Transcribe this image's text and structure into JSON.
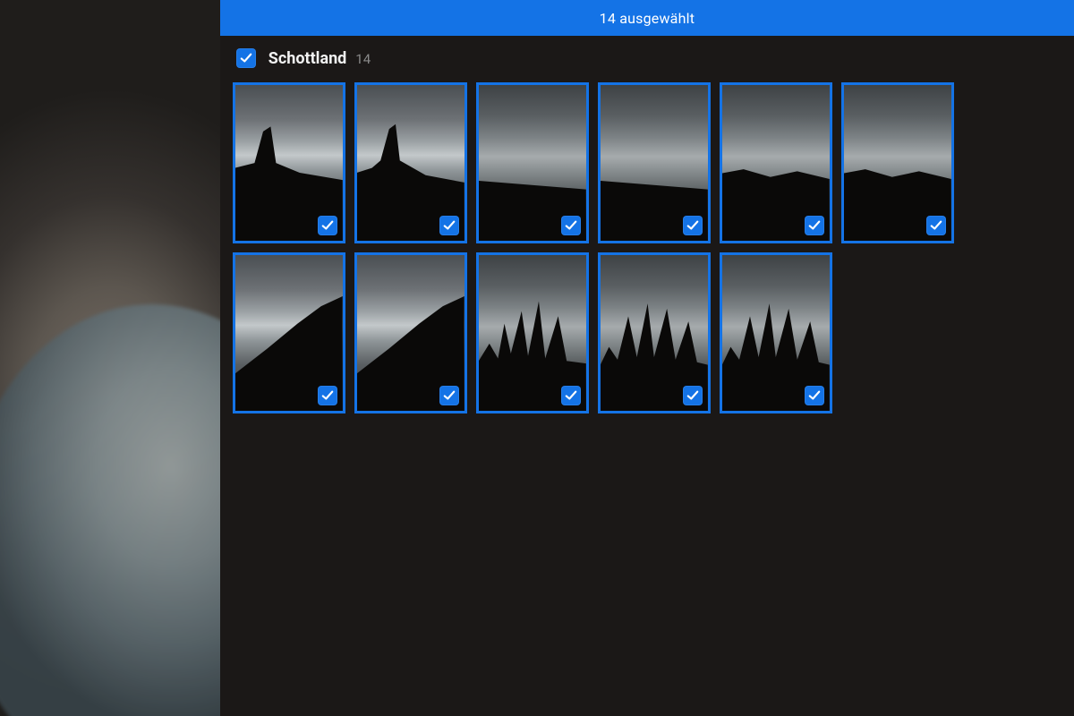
{
  "colors": {
    "accent": "#1473e6",
    "panel": "#1b1817"
  },
  "topbar": {
    "selected_text": "14 ausgewählt"
  },
  "album": {
    "checked": true,
    "title": "Schottland",
    "count": "14"
  },
  "thumbnails": [
    {
      "selected": true,
      "sky": "a",
      "sil": "monolith"
    },
    {
      "selected": true,
      "sky": "a",
      "sil": "monolith2"
    },
    {
      "selected": true,
      "sky": "b",
      "sil": "low"
    },
    {
      "selected": true,
      "sky": "b",
      "sil": "low"
    },
    {
      "selected": true,
      "sky": "b",
      "sil": "flat"
    },
    {
      "selected": true,
      "sky": "b",
      "sil": "flat"
    },
    {
      "selected": true,
      "sky": "a",
      "sil": "slope"
    },
    {
      "selected": true,
      "sky": "a",
      "sil": "slope"
    },
    {
      "selected": true,
      "sky": "b",
      "sil": "peaks"
    },
    {
      "selected": true,
      "sky": "b",
      "sil": "peaks2"
    },
    {
      "selected": true,
      "sky": "b",
      "sil": "peaks2"
    }
  ]
}
